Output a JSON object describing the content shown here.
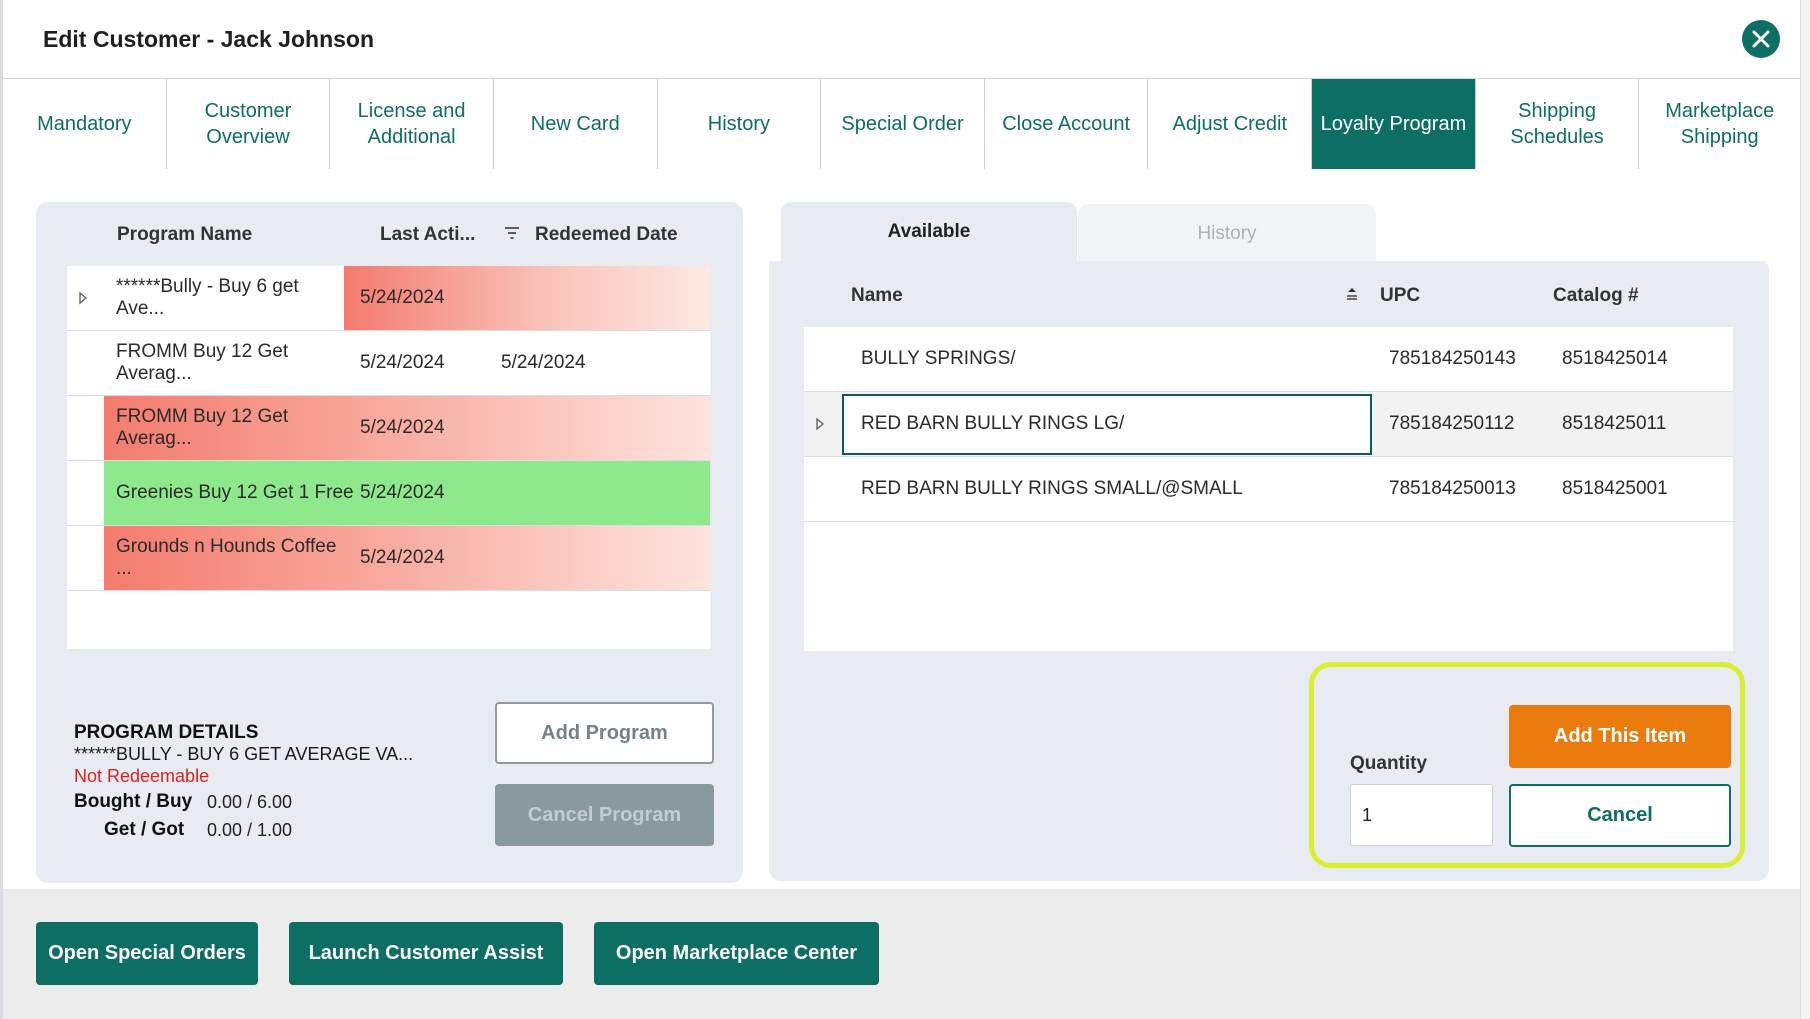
{
  "window": {
    "title": "Edit Customer - Jack Johnson",
    "accent_color": "#0d6e63",
    "close_icon": "close-icon"
  },
  "tabs": [
    {
      "label": "Mandatory",
      "active": false
    },
    {
      "label": "Customer Overview",
      "active": false
    },
    {
      "label": "License and Additional",
      "active": false
    },
    {
      "label": "New Card",
      "active": false
    },
    {
      "label": "History",
      "active": false
    },
    {
      "label": "Special Order",
      "active": false
    },
    {
      "label": "Close Account",
      "active": false
    },
    {
      "label": "Adjust Credit",
      "active": false
    },
    {
      "label": "Loyalty Program",
      "active": true
    },
    {
      "label": "Shipping Schedules",
      "active": false
    },
    {
      "label": "Marketplace Shipping",
      "active": false
    }
  ],
  "programs": {
    "columns": [
      "Program Name",
      "Last Acti...",
      "Redeemed Date"
    ],
    "rows": [
      {
        "name": "******Bully -  Buy 6 get Ave...",
        "last_activity": "5/24/2024",
        "redeemed_date": "",
        "status_color": "red",
        "expandable": true
      },
      {
        "name": "FROMM Buy 12 Get Averag...",
        "last_activity": "5/24/2024",
        "redeemed_date": "5/24/2024",
        "status_color": "none",
        "expandable": false
      },
      {
        "name": "FROMM Buy 12 Get Averag...",
        "last_activity": "5/24/2024",
        "redeemed_date": "",
        "status_color": "red",
        "expandable": false
      },
      {
        "name": "Greenies Buy 12 Get 1 Free",
        "last_activity": "5/24/2024",
        "redeemed_date": "",
        "status_color": "green",
        "expandable": false
      },
      {
        "name": "Grounds n Hounds Coffee ...",
        "last_activity": "5/24/2024",
        "redeemed_date": "",
        "status_color": "red",
        "expandable": false
      }
    ]
  },
  "program_details": {
    "heading": "PROGRAM DETAILS",
    "name": "******BULLY -  BUY 6 GET AVERAGE VA...",
    "status": "Not Redeemable",
    "bought_buy_label": "Bought / Buy",
    "bought_buy_value": "0.00 / 6.00",
    "get_got_label": "Get / Got",
    "get_got_value": "0.00 / 1.00",
    "add_program_label": "Add Program",
    "cancel_program_label": "Cancel Program"
  },
  "items_panel": {
    "tabs": [
      "Available",
      "History"
    ],
    "columns": [
      "Name",
      "UPC",
      "Catalog #"
    ],
    "rows": [
      {
        "name": "BULLY SPRINGS/",
        "upc": "785184250143",
        "catalog": "8518425014"
      },
      {
        "name": "RED BARN BULLY RINGS LG/",
        "upc": "785184250112",
        "catalog": "8518425011"
      },
      {
        "name": "RED BARN BULLY RINGS SMALL/@SMALL",
        "upc": "785184250013",
        "catalog": "8518425001"
      }
    ],
    "quantity_label": "Quantity",
    "quantity_value": "1",
    "add_item_label": "Add This Item",
    "cancel_label": "Cancel"
  },
  "footer": {
    "buttons": [
      "Open Special Orders",
      "Launch Customer Assist",
      "Open Marketplace Center"
    ]
  }
}
